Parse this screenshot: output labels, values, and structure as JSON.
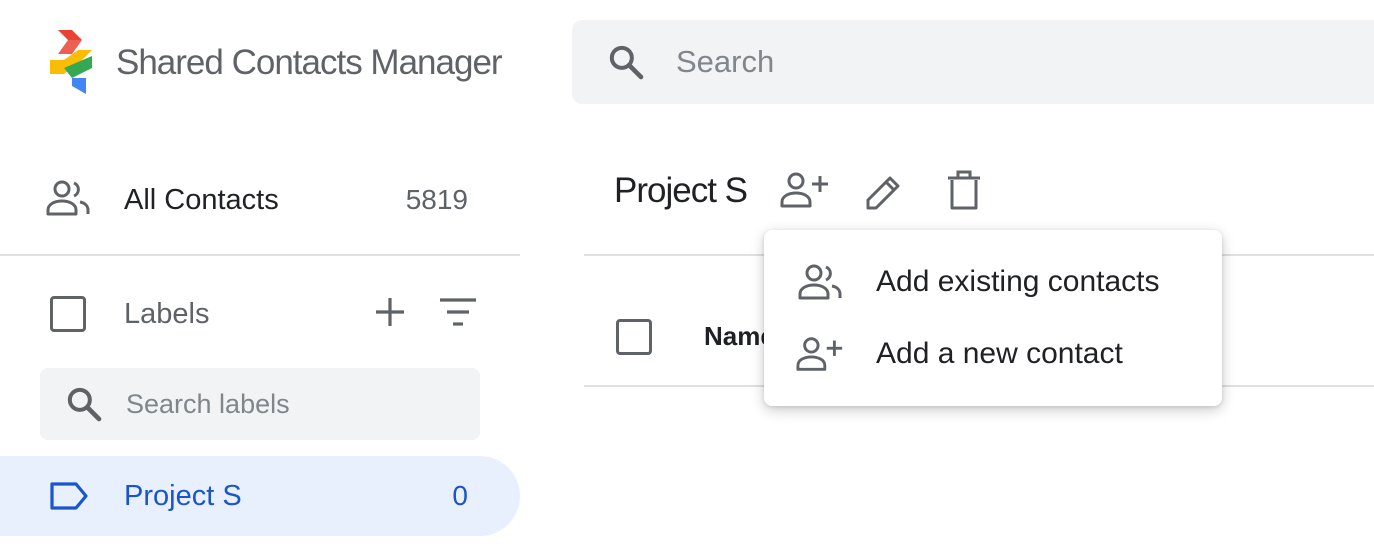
{
  "header": {
    "app_title": "Shared Contacts Manager",
    "search_placeholder": "Search"
  },
  "sidebar": {
    "all_contacts": {
      "label": "All Contacts",
      "count": "5819"
    },
    "labels": {
      "heading": "Labels",
      "search_placeholder": "Search labels",
      "items": [
        {
          "label": "Project S",
          "count": "0",
          "active": true
        }
      ]
    }
  },
  "main": {
    "title": "Project S",
    "table_header": {
      "name": "Name"
    }
  },
  "dropdown_menu": {
    "items": [
      {
        "label": "Add existing contacts",
        "icon": "people-icon"
      },
      {
        "label": "Add a new contact",
        "icon": "person-add-icon"
      }
    ]
  },
  "colors": {
    "accent_blue": "#1a56c9",
    "active_bg": "#e8f0fe",
    "search_bg": "#f1f3f4",
    "icon_gray": "#5f6368"
  }
}
